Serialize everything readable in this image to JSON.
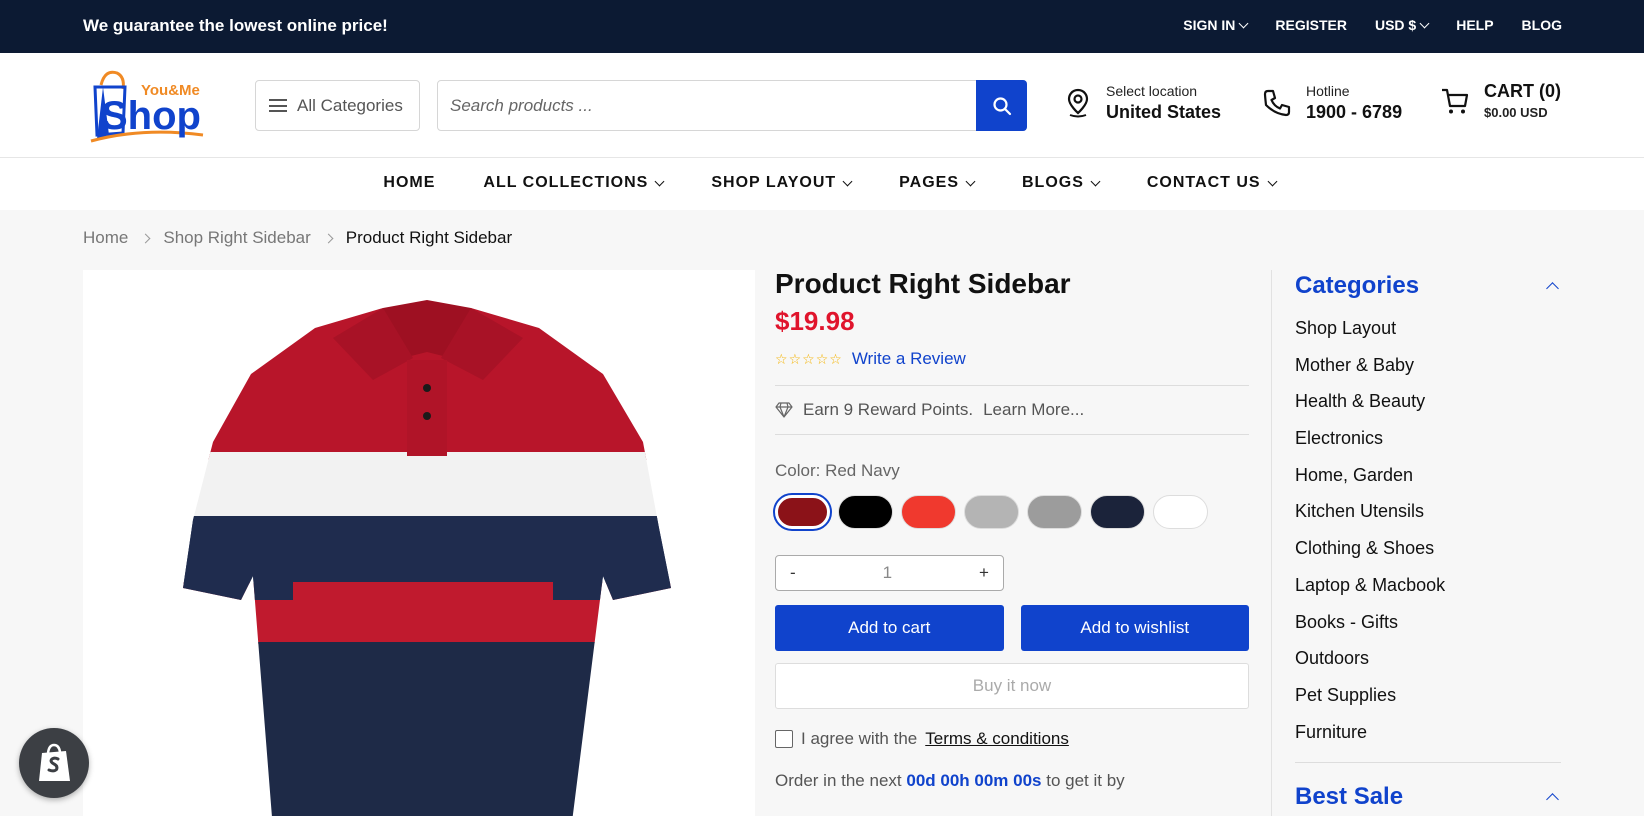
{
  "topbar": {
    "promo": "We guarantee the lowest online price!",
    "links": [
      "SIGN IN",
      "REGISTER",
      "USD $",
      "HELP",
      "BLOG"
    ]
  },
  "header": {
    "logo_top": "You&Me",
    "logo_main": "Shop",
    "all_categories": "All Categories",
    "search_placeholder": "Search products ...",
    "location_label": "Select location",
    "location_value": "United States",
    "hotline_label": "Hotline",
    "hotline_value": "1900 - 6789",
    "cart_label": "CART (0)",
    "cart_total": "$0.00 USD"
  },
  "nav": {
    "items": [
      "HOME",
      "ALL COLLECTIONS",
      "SHOP LAYOUT",
      "PAGES",
      "BLOGS",
      "CONTACT US"
    ]
  },
  "breadcrumb": [
    "Home",
    "Shop Right Sidebar",
    "Product Right Sidebar"
  ],
  "product": {
    "title": "Product Right Sidebar",
    "price": "$19.98",
    "rating": 0,
    "write_review": "Write a Review",
    "rewards": "Earn 9 Reward Points.",
    "learn_more": "Learn More...",
    "color_label": "Color: Red Navy",
    "swatches": [
      "#8b1218",
      "#000000",
      "#f0392e",
      "#b4b4b4",
      "#9c9c9c",
      "#1b233a",
      "#ffffff"
    ],
    "qty_minus": "-",
    "qty_value": "1",
    "qty_plus": "+",
    "add_to_cart": "Add to cart",
    "add_to_wishlist": "Add to wishlist",
    "buy_now": "Buy it now",
    "agree_text": "I agree with the",
    "terms": "Terms & conditions",
    "order_prefix": "Order in the next",
    "countdown": "00d 00h 00m 00s",
    "order_suffix": "to get it by"
  },
  "sidebar": {
    "categories_title": "Categories",
    "categories": [
      "Shop Layout",
      "Mother & Baby",
      "Health & Beauty",
      "Electronics",
      "Home, Garden",
      "Kitchen Utensils",
      "Clothing & Shoes",
      "Laptop & Macbook",
      "Books - Gifts",
      "Outdoors",
      "Pet Supplies",
      "Furniture"
    ],
    "best_sale_title": "Best Sale"
  },
  "colors": {
    "accent": "#1043cc",
    "topbar": "#0c1a33",
    "price": "#e0142c"
  }
}
